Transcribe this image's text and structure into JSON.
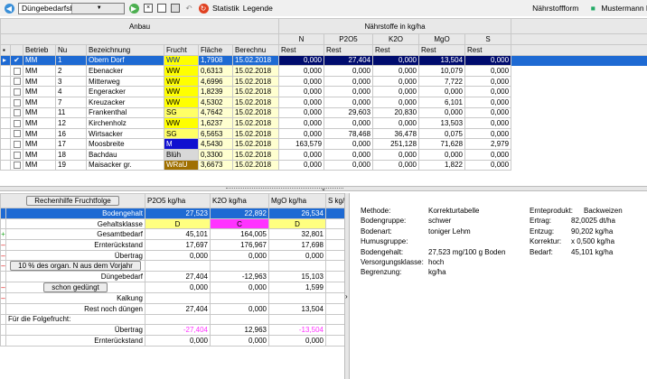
{
  "toolbar": {
    "dropdown_value": "Düngebedarfsberechnung",
    "statistik_label": "Statistik",
    "legende_label": "Legende",
    "right_label": "Nährstoffform",
    "user_label": "Mustermann M"
  },
  "top_grid": {
    "group_anbau": "Anbau",
    "group_naehrstoffe": "Nährstoffe in kg/ha",
    "nutrients": [
      "N",
      "P2O5",
      "K2O",
      "MgO",
      "S"
    ],
    "columns": [
      "Betrieb",
      "Nu",
      "Bezeichnung",
      "Frucht",
      "Fläche",
      "Berechnu",
      "Rest",
      "Rest",
      "Rest",
      "Rest",
      "Rest"
    ],
    "rows": [
      {
        "checked": "✔",
        "betrieb": "MM",
        "nr": "1",
        "bez": "Obern Dorf",
        "frucht": "WW",
        "flaeche": "1,7908",
        "datum": "15.02.2018",
        "n": "0,000",
        "p": "27,404",
        "k": "0,000",
        "mg": "13,504",
        "s": "0,000",
        "fcolor": "#ffff00"
      },
      {
        "checked": "",
        "betrieb": "MM",
        "nr": "2",
        "bez": "Ebenacker",
        "frucht": "WW",
        "flaeche": "0,6313",
        "datum": "15.02.2018",
        "n": "0,000",
        "p": "0,000",
        "k": "0,000",
        "mg": "10,079",
        "s": "0,000",
        "fcolor": "#ffff00"
      },
      {
        "checked": "",
        "betrieb": "MM",
        "nr": "3",
        "bez": "Mitterweg",
        "frucht": "WW",
        "flaeche": "4,6996",
        "datum": "15.02.2018",
        "n": "0,000",
        "p": "0,000",
        "k": "0,000",
        "mg": "7,722",
        "s": "0,000",
        "fcolor": "#ffff00"
      },
      {
        "checked": "",
        "betrieb": "MM",
        "nr": "4",
        "bez": "Engeracker",
        "frucht": "WW",
        "flaeche": "1,8239",
        "datum": "15.02.2018",
        "n": "0,000",
        "p": "0,000",
        "k": "0,000",
        "mg": "0,000",
        "s": "0,000",
        "fcolor": "#ffff00"
      },
      {
        "checked": "",
        "betrieb": "MM",
        "nr": "7",
        "bez": "Kreuzacker",
        "frucht": "WW",
        "flaeche": "4,5302",
        "datum": "15.02.2018",
        "n": "0,000",
        "p": "0,000",
        "k": "0,000",
        "mg": "6,101",
        "s": "0,000",
        "fcolor": "#ffff00"
      },
      {
        "checked": "",
        "betrieb": "MM",
        "nr": "11",
        "bez": "Frankenthal",
        "frucht": "SG",
        "flaeche": "4,7642",
        "datum": "15.02.2018",
        "n": "0,000",
        "p": "29,603",
        "k": "20,830",
        "mg": "0,000",
        "s": "0,000",
        "fcolor": "#ffff66"
      },
      {
        "checked": "",
        "betrieb": "MM",
        "nr": "12",
        "bez": "Kirchenholz",
        "frucht": "WW",
        "flaeche": "1,6237",
        "datum": "15.02.2018",
        "n": "0,000",
        "p": "0,000",
        "k": "0,000",
        "mg": "13,503",
        "s": "0,000",
        "fcolor": "#ffff00"
      },
      {
        "checked": "",
        "betrieb": "MM",
        "nr": "16",
        "bez": "Wirtsacker",
        "frucht": "SG",
        "flaeche": "6,5653",
        "datum": "15.02.2018",
        "n": "0,000",
        "p": "78,468",
        "k": "36,478",
        "mg": "0,075",
        "s": "0,000",
        "fcolor": "#ffff66"
      },
      {
        "checked": "",
        "betrieb": "MM",
        "nr": "17",
        "bez": "Moosbreite",
        "frucht": "M",
        "flaeche": "4,5430",
        "datum": "15.02.2018",
        "n": "163,579",
        "p": "0,000",
        "k": "251,128",
        "mg": "71,628",
        "s": "2,979",
        "fcolor": "#1010d0"
      },
      {
        "checked": "",
        "betrieb": "MM",
        "nr": "18",
        "bez": "Bachdau",
        "frucht": "Blüh",
        "flaeche": "0,3300",
        "datum": "15.02.2018",
        "n": "0,000",
        "p": "0,000",
        "k": "0,000",
        "mg": "0,000",
        "s": "0,000",
        "fcolor": "#d8d8d8"
      },
      {
        "checked": "",
        "betrieb": "MM",
        "nr": "19",
        "bez": "Maisacker gr.",
        "frucht": "WRaU",
        "flaeche": "3,6673",
        "datum": "15.02.2018",
        "n": "0,000",
        "p": "0,000",
        "k": "0,000",
        "mg": "1,822",
        "s": "0,000",
        "fcolor": "#a07000"
      }
    ]
  },
  "calc": {
    "title": "Rechenhilfe Fruchtfolge",
    "cols": [
      "P2O5 kg/ha",
      "K2O kg/ha",
      "MgO kg/ha",
      "S kg/"
    ],
    "rows": [
      {
        "mark": "",
        "label": "Bodengehalt",
        "p": "27,523",
        "k": "22,892",
        "mg": "26,534",
        "style": "blue"
      },
      {
        "mark": "",
        "label": "Gehaltsklasse",
        "p": "D",
        "k": "C",
        "mg": "D",
        "style": "class"
      },
      {
        "mark": "+",
        "label": "Gesamtbedarf",
        "p": "45,101",
        "k": "164,005",
        "mg": "32,801",
        "style": ""
      },
      {
        "mark": "–",
        "label": "Ernterückstand",
        "p": "17,697",
        "k": "176,967",
        "mg": "17,698",
        "style": ""
      },
      {
        "mark": "–",
        "label": "Übertrag",
        "p": "0,000",
        "k": "0,000",
        "mg": "0,000",
        "style": ""
      },
      {
        "mark": "–",
        "label": "10 % des organ. N aus dem Vorjahr",
        "p": "",
        "k": "",
        "mg": "",
        "style": "button"
      },
      {
        "mark": "",
        "label": "Düngebedarf",
        "p": "27,404",
        "k": "-12,963",
        "mg": "15,103",
        "style": ""
      },
      {
        "mark": "–",
        "label": "schon gedüngt",
        "p": "0,000",
        "k": "0,000",
        "mg": "1,599",
        "style": "button"
      },
      {
        "mark": "–",
        "label": "Kalkung",
        "p": "",
        "k": "",
        "mg": "",
        "style": ""
      },
      {
        "mark": "",
        "label": "Rest noch düngen",
        "p": "27,404",
        "k": "0,000",
        "mg": "13,504",
        "style": ""
      },
      {
        "mark": "",
        "label": "Für die Folgefrucht:",
        "p": "",
        "k": "",
        "mg": "",
        "style": "left"
      },
      {
        "mark": "",
        "label": "Übertrag",
        "p": "-27,404",
        "k": "12,963",
        "mg": "-13,504",
        "style": "neg"
      },
      {
        "mark": "",
        "label": "Ernterückstand",
        "p": "0,000",
        "k": "0,000",
        "mg": "0,000",
        "style": ""
      }
    ]
  },
  "info_left": [
    {
      "k": "Methode:",
      "v": "Korrekturtabelle"
    },
    {
      "k": "Bodengruppe:",
      "v": "schwer"
    },
    {
      "k": "Bodenart:",
      "v": "toniger Lehm"
    },
    {
      "k": "Humusgruppe:",
      "v": ""
    },
    {
      "k": "Bodengehalt:",
      "v": "27,523 mg/100 g Boden"
    },
    {
      "k": "Versorgungsklasse:",
      "v": "hoch"
    },
    {
      "k": "Begrenzung:",
      "v": "kg/ha"
    }
  ],
  "info_right_header": {
    "k": "Ernteprodukt:",
    "v": "Backweizen"
  },
  "info_right": [
    {
      "k": "Ertrag:",
      "v": "82,0025 dt/ha"
    },
    {
      "k": "Entzug:",
      "v": "90,202 kg/ha"
    },
    {
      "k": "Korrektur:",
      "v": "x 0,500 kg/ha"
    },
    {
      "k": "Bedarf:",
      "v": "45,101 kg/ha"
    }
  ]
}
